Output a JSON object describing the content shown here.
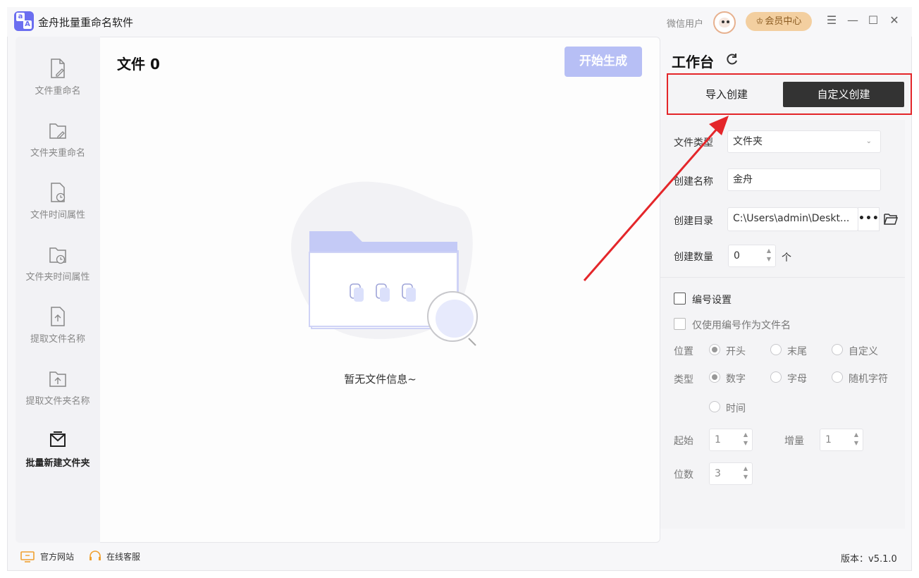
{
  "app": {
    "title": "金舟批量重命名软件",
    "logo_a_small": "a",
    "logo_a_big": "A"
  },
  "titlebar": {
    "user_name": "微信用户",
    "vip_label": "会员中心",
    "menu_glyph": "☰",
    "minimize_glyph": "—",
    "maximize_glyph": "☐",
    "close_glyph": "✕"
  },
  "sidebar": {
    "items": [
      {
        "label": "文件重命名",
        "icon": "file-edit-icon"
      },
      {
        "label": "文件夹重命名",
        "icon": "folder-edit-icon"
      },
      {
        "label": "文件时间属性",
        "icon": "file-clock-icon"
      },
      {
        "label": "文件夹时间属性",
        "icon": "folder-clock-icon"
      },
      {
        "label": "提取文件名称",
        "icon": "file-upload-icon"
      },
      {
        "label": "提取文件夹名称",
        "icon": "folder-upload-icon"
      },
      {
        "label": "批量新建文件夹",
        "icon": "folder-new-icon",
        "active": true
      }
    ]
  },
  "main": {
    "file_title": "文件 0",
    "start_button": "开始生成",
    "empty_text": "暂无文件信息~"
  },
  "workbench": {
    "title": "工作台",
    "tabs": {
      "import": "导入创建",
      "custom": "自定义创建"
    },
    "file_type_label": "文件类型",
    "file_type_value": "文件夹",
    "create_name_label": "创建名称",
    "create_name_value": "金舟",
    "create_dir_label": "创建目录",
    "create_dir_value": "C:\\Users\\admin\\Deskt...",
    "dir_more": "•••",
    "create_count_label": "创建数量",
    "create_count_value": "0",
    "count_unit": "个",
    "numbering_label": "编号设置",
    "only_number_label": "仅使用编号作为文件名",
    "position_label": "位置",
    "position_options": [
      "开头",
      "末尾",
      "自定义"
    ],
    "type_label": "类型",
    "type_options": [
      "数字",
      "字母",
      "随机字符",
      "时间"
    ],
    "start_label": "起始",
    "start_value": "1",
    "increment_label": "增量",
    "increment_value": "1",
    "digits_label": "位数",
    "digits_value": "3"
  },
  "footer": {
    "website": "官方网站",
    "support": "在线客服",
    "version": "版本：v5.1.0"
  },
  "colors": {
    "accent": "#6b6ef0",
    "start_button": "#b7bff5",
    "highlight_red": "#e4262a",
    "tab_active_bg": "#333333",
    "vip_bg": "#f3cfa0"
  }
}
